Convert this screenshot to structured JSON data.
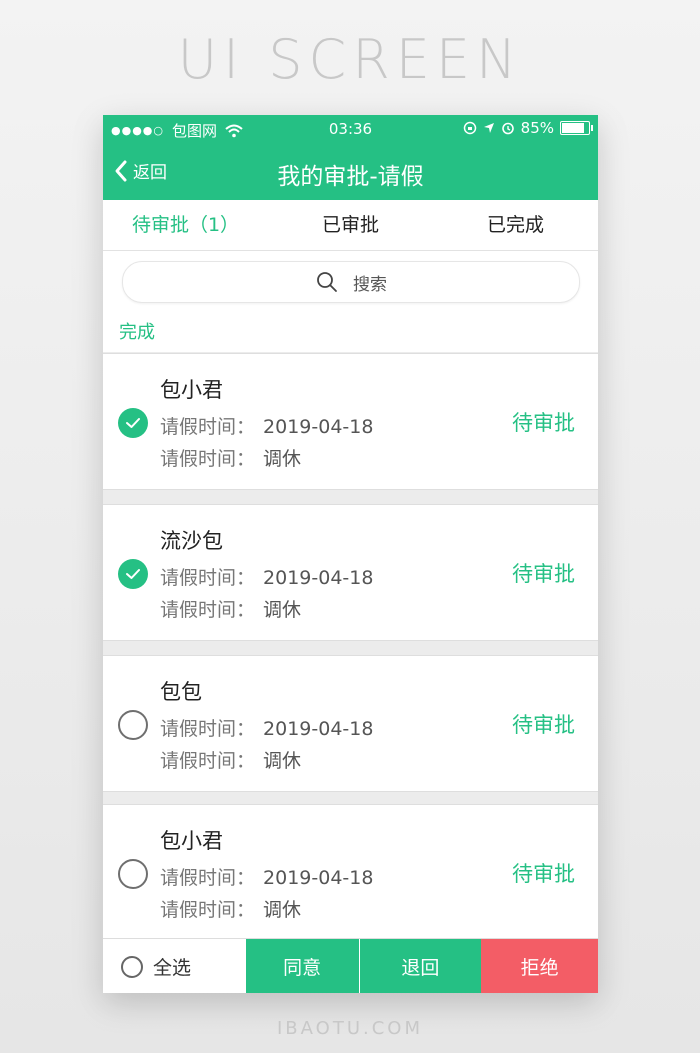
{
  "headline": "UI SCREEN",
  "footer_brand": "IBAOTU.COM",
  "statusbar": {
    "signal": "●●●●○",
    "carrier": "包图网",
    "time": "03:36",
    "battery": "85%"
  },
  "navbar": {
    "back_label": "返回",
    "title": "我的审批-请假"
  },
  "tabs": [
    {
      "label": "待审批（1）",
      "active": true
    },
    {
      "label": "已审批",
      "active": false
    },
    {
      "label": "已完成",
      "active": false
    }
  ],
  "search": {
    "placeholder": "搜索"
  },
  "section_label": "完成",
  "items": [
    {
      "name": "包小君",
      "time_label": "请假时间：",
      "time_value": "2019-04-18",
      "type_label": "请假时间：",
      "type_value": "调休",
      "status": "待审批",
      "checked": true
    },
    {
      "name": "流沙包",
      "time_label": "请假时间：",
      "time_value": "2019-04-18",
      "type_label": "请假时间：",
      "type_value": "调休",
      "status": "待审批",
      "checked": true
    },
    {
      "name": "包包",
      "time_label": "请假时间：",
      "time_value": "2019-04-18",
      "type_label": "请假时间：",
      "type_value": "调休",
      "status": "待审批",
      "checked": false
    },
    {
      "name": "包小君",
      "time_label": "请假时间：",
      "time_value": "2019-04-18",
      "type_label": "请假时间：",
      "type_value": "调休",
      "status": "待审批",
      "checked": false
    }
  ],
  "bottombar": {
    "select_all": "全选",
    "agree": "同意",
    "return": "退回",
    "reject": "拒绝"
  },
  "colors": {
    "accent": "#25c084",
    "danger": "#f35d66"
  }
}
